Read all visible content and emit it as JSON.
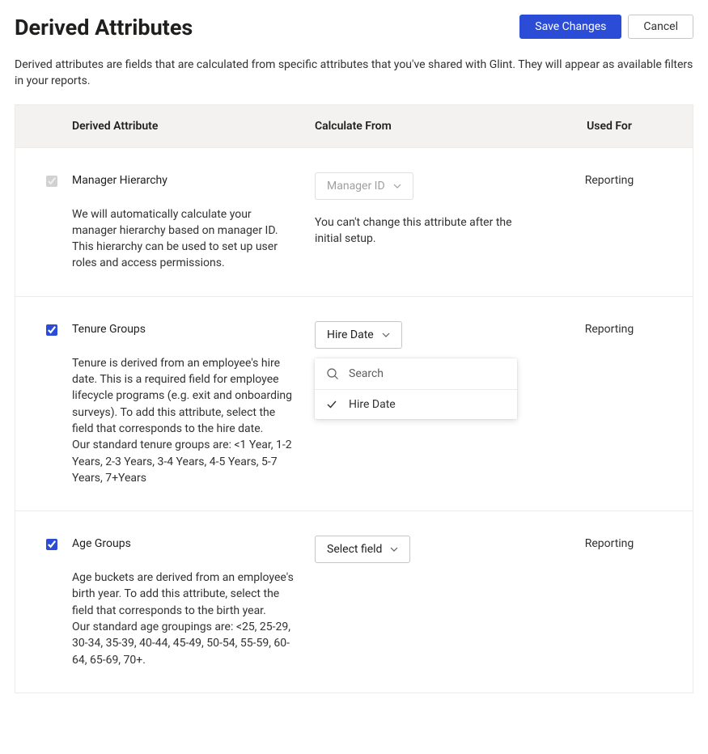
{
  "header": {
    "title": "Derived Attributes",
    "subtitle": "Derived attributes are fields that are calculated from specific attributes that you've shared with Glint. They will appear as available filters in your reports.",
    "save_label": "Save Changes",
    "cancel_label": "Cancel"
  },
  "table": {
    "columns": {
      "attribute": "Derived Attribute",
      "calc": "Calculate From",
      "used": "Used For"
    }
  },
  "rows": {
    "manager": {
      "title": "Manager Hierarchy",
      "desc": "We will automatically calculate your manager hierarchy based on manager ID. This hierarchy can be used to set up user roles and access permissions.",
      "select": "Manager ID",
      "helper": "You can't change this attribute after the initial setup.",
      "used": "Reporting"
    },
    "tenure": {
      "title": "Tenure Groups",
      "desc": "Tenure is derived from an employee's hire date. This is a required field for employee lifecycle programs (e.g. exit and onboarding surveys). To add this attribute, select the field that corresponds to the hire date.\nOur standard tenure groups are: <1 Year, 1-2 Years, 2-3 Years, 3-4 Years, 4-5 Years, 5-7 Years, 7+Years",
      "select": "Hire Date",
      "used": "Reporting",
      "dropdown": {
        "search_placeholder": "Search",
        "option": "Hire Date"
      }
    },
    "age": {
      "title": "Age Groups",
      "desc": "Age buckets are derived from an employee's birth year. To add this attribute, select the field that corresponds to the birth year.\nOur standard age groupings are: <25, 25-29, 30-34, 35-39, 40-44, 45-49, 50-54, 55-59, 60-64, 65-69, 70+.",
      "select": "Select field",
      "used": "Reporting"
    }
  }
}
